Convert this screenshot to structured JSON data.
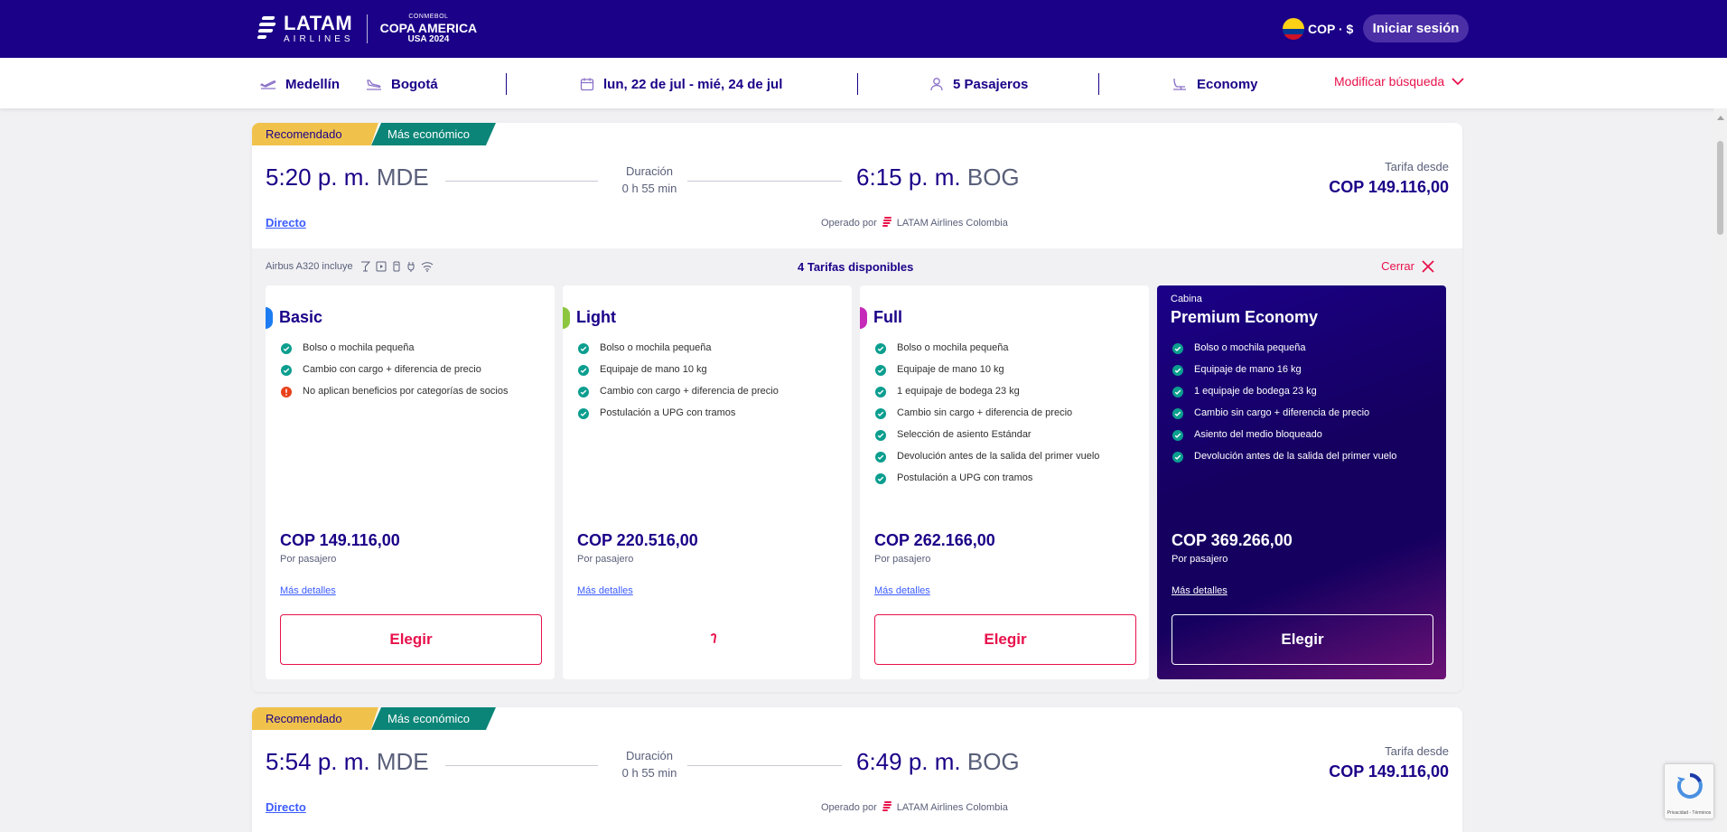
{
  "header": {
    "logo_name": "LATAM",
    "logo_sub": "AIRLINES",
    "copa_top": "CONMEBOL",
    "copa_main": "COPA AMERICA",
    "copa_sub": "USA 2024",
    "currency": "COP · $",
    "login_label": "Iniciar sesión",
    "colors": {
      "primary": "#1b0088",
      "accent": "#e8114b",
      "button": "#4b2fa7"
    }
  },
  "search": {
    "origin": "Medellín",
    "destination": "Bogotá",
    "dates": "lun, 22 de jul - mié, 24 de jul",
    "passengers": "5 Pasajeros",
    "cabin": "Economy",
    "modify_label": "Modificar búsqueda"
  },
  "flights": [
    {
      "tag_recommended": "Recomendado",
      "tag_cheapest": "Más económico",
      "dep_time": "5:20 p. m.",
      "dep_code": "MDE",
      "duration_label": "Duración",
      "duration": "0 h 55 min",
      "arr_time": "6:15 p. m.",
      "arr_code": "BOG",
      "fare_from_label": "Tarifa desde",
      "fare_from": "COP 149.116,00",
      "stops": "Directo",
      "operated_label": "Operado por",
      "operator": "LATAM Airlines Colombia",
      "aircraft": "Airbus A320",
      "includes_label": "incluye",
      "amenities": [
        "drinks-icon",
        "entertainment-icon",
        "usb-icon",
        "power-icon",
        "wifi-icon"
      ],
      "fares_count": "4 Tarifas disponibles",
      "close_label": "Cerrar",
      "fares": [
        {
          "name": "Basic",
          "accent": "#1e7cf2",
          "benefits": [
            {
              "text": "Bolso o mochila pequeña",
              "status": "included"
            },
            {
              "text": "Cambio con cargo + diferencia de precio",
              "status": "included"
            },
            {
              "text": "No aplican beneficios por categorías de socios",
              "status": "warning"
            }
          ],
          "price": "COP 149.116,00",
          "per": "Por pasajero",
          "details": "Más detalles",
          "choose": "Elegir",
          "state": "ready"
        },
        {
          "name": "Light",
          "accent": "#8cc63f",
          "benefits": [
            {
              "text": "Bolso o mochila pequeña",
              "status": "included"
            },
            {
              "text": "Equipaje de mano 10 kg",
              "status": "included"
            },
            {
              "text": "Cambio con cargo + diferencia de precio",
              "status": "included"
            },
            {
              "text": "Postulación a UPG con tramos",
              "status": "included"
            }
          ],
          "price": "COP 220.516,00",
          "per": "Por pasajero",
          "details": "Más detalles",
          "choose": "",
          "state": "loading"
        },
        {
          "name": "Full",
          "accent": "#c52ab8",
          "benefits": [
            {
              "text": "Bolso o mochila pequeña",
              "status": "included"
            },
            {
              "text": "Equipaje de mano 10 kg",
              "status": "included"
            },
            {
              "text": "1 equipaje de bodega 23 kg",
              "status": "included"
            },
            {
              "text": "Cambio sin cargo + diferencia de precio",
              "status": "included"
            },
            {
              "text": "Selección de asiento Estándar",
              "status": "included"
            },
            {
              "text": "Devolución antes de la salida del primer vuelo",
              "status": "included"
            },
            {
              "text": "Postulación a UPG con tramos",
              "status": "included"
            }
          ],
          "price": "COP 262.166,00",
          "per": "Por pasajero",
          "details": "Más detalles",
          "choose": "Elegir",
          "state": "ready"
        },
        {
          "cabin_label": "Cabina",
          "name": "Premium Economy",
          "accent": "#1b0088",
          "benefits": [
            {
              "text": "Bolso o mochila pequeña",
              "status": "included"
            },
            {
              "text": "Equipaje de mano 16 kg",
              "status": "included"
            },
            {
              "text": "1 equipaje de bodega 23 kg",
              "status": "included"
            },
            {
              "text": "Cambio sin cargo + diferencia de precio",
              "status": "included"
            },
            {
              "text": "Asiento del medio bloqueado",
              "status": "included"
            },
            {
              "text": "Devolución antes de la salida del primer vuelo",
              "status": "included"
            }
          ],
          "price": "COP 369.266,00",
          "per": "Por pasajero",
          "details": "Más detalles",
          "choose": "Elegir",
          "state": "ready"
        }
      ]
    },
    {
      "tag_recommended": "Recomendado",
      "tag_cheapest": "Más económico",
      "dep_time": "5:54 p. m.",
      "dep_code": "MDE",
      "duration_label": "Duración",
      "duration": "0 h 55 min",
      "arr_time": "6:49 p. m.",
      "arr_code": "BOG",
      "fare_from_label": "Tarifa desde",
      "fare_from": "COP 149.116,00",
      "stops": "Directo",
      "operated_label": "Operado por",
      "operator": "LATAM Airlines Colombia"
    }
  ],
  "recaptcha": {
    "text": "Privacidad - Términos"
  },
  "icon_colors": {
    "check": "#0b9e8f",
    "warning": "#e8411b"
  }
}
